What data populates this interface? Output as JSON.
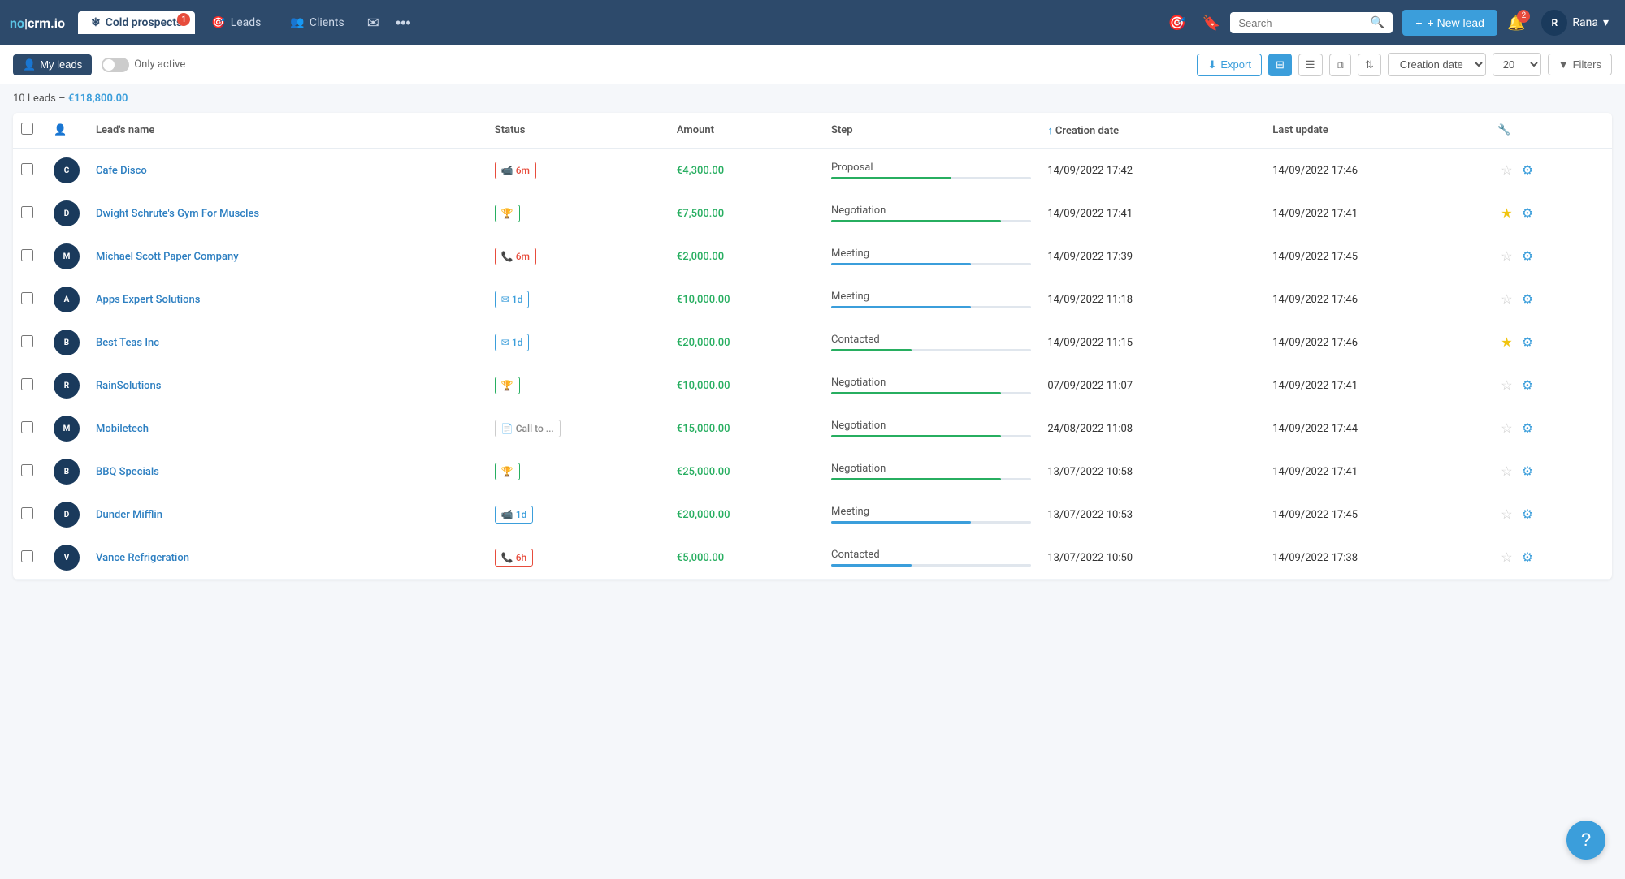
{
  "logo": "no|crm.io",
  "nav": {
    "tabs": [
      {
        "id": "cold-prospects",
        "label": "Cold prospects",
        "icon": "❄",
        "active": true,
        "badge": "1"
      },
      {
        "id": "leads",
        "label": "Leads",
        "icon": "🎯",
        "active": false
      },
      {
        "id": "clients",
        "label": "Clients",
        "icon": "👥",
        "active": false
      }
    ],
    "search_placeholder": "Search",
    "new_lead_label": "+ New lead",
    "notif_count": "2",
    "user_name": "Rana"
  },
  "subtoolbar": {
    "my_leads_label": "My leads",
    "only_active_label": "Only active",
    "export_label": "Export",
    "date_sort_label": "Creation date",
    "per_page": "20",
    "filters_label": "Filters"
  },
  "summary": {
    "count": "10 Leads",
    "amount": "€118,800.00"
  },
  "table": {
    "columns": [
      "Lead's name",
      "Status",
      "Amount",
      "Step",
      "Creation date",
      "Last update"
    ],
    "rows": [
      {
        "id": 1,
        "name": "Cafe Disco",
        "status_label": "6m",
        "status_type": "red",
        "status_icon": "📹",
        "amount": "€4,300.00",
        "step": "Proposal",
        "step_pct": 60,
        "step_color": "green",
        "created": "14/09/2022 17:42",
        "updated": "14/09/2022 17:46",
        "starred": false
      },
      {
        "id": 2,
        "name": "Dwight Schrute's Gym For Muscles",
        "status_label": "🏆",
        "status_type": "green",
        "status_icon": "",
        "amount": "€7,500.00",
        "step": "Negotiation",
        "step_pct": 85,
        "step_color": "green",
        "created": "14/09/2022 17:41",
        "updated": "14/09/2022 17:41",
        "starred": true
      },
      {
        "id": 3,
        "name": "Michael Scott Paper Company",
        "status_label": "6m",
        "status_type": "red",
        "status_icon": "📞",
        "amount": "€2,000.00",
        "step": "Meeting",
        "step_pct": 70,
        "step_color": "blue",
        "created": "14/09/2022 17:39",
        "updated": "14/09/2022 17:45",
        "starred": false
      },
      {
        "id": 4,
        "name": "Apps Expert Solutions",
        "status_label": "1d",
        "status_type": "blue",
        "status_icon": "✉",
        "amount": "€10,000.00",
        "step": "Meeting",
        "step_pct": 70,
        "step_color": "blue",
        "created": "14/09/2022 11:18",
        "updated": "14/09/2022 17:46",
        "starred": false
      },
      {
        "id": 5,
        "name": "Best Teas Inc",
        "status_label": "1d",
        "status_type": "blue",
        "status_icon": "✉",
        "amount": "€20,000.00",
        "step": "Contacted",
        "step_pct": 40,
        "step_color": "green",
        "created": "14/09/2022 11:15",
        "updated": "14/09/2022 17:46",
        "starred": true
      },
      {
        "id": 6,
        "name": "RainSolutions",
        "status_label": "🏆",
        "status_type": "green",
        "status_icon": "",
        "amount": "€10,000.00",
        "step": "Negotiation",
        "step_pct": 85,
        "step_color": "green",
        "created": "07/09/2022 11:07",
        "updated": "14/09/2022 17:41",
        "starred": false
      },
      {
        "id": 7,
        "name": "Mobiletech",
        "status_label": "Call to ...",
        "status_type": "gray",
        "status_icon": "📄",
        "amount": "€15,000.00",
        "step": "Negotiation",
        "step_pct": 85,
        "step_color": "green",
        "created": "24/08/2022 11:08",
        "updated": "14/09/2022 17:44",
        "starred": false
      },
      {
        "id": 8,
        "name": "BBQ Specials",
        "status_label": "🏆",
        "status_type": "green",
        "status_icon": "",
        "amount": "€25,000.00",
        "step": "Negotiation",
        "step_pct": 85,
        "step_color": "green",
        "created": "13/07/2022 10:58",
        "updated": "14/09/2022 17:41",
        "starred": false
      },
      {
        "id": 9,
        "name": "Dunder Mifflin",
        "status_label": "1d",
        "status_type": "blue",
        "status_icon": "📹",
        "amount": "€20,000.00",
        "step": "Meeting",
        "step_pct": 70,
        "step_color": "blue",
        "created": "13/07/2022 10:53",
        "updated": "14/09/2022 17:45",
        "starred": false
      },
      {
        "id": 10,
        "name": "Vance Refrigeration",
        "status_label": "6h",
        "status_type": "red",
        "status_icon": "📞",
        "amount": "€5,000.00",
        "step": "Contacted",
        "step_pct": 40,
        "step_color": "blue",
        "created": "13/07/2022 10:50",
        "updated": "14/09/2022 17:38",
        "starred": false
      }
    ]
  },
  "help_label": "?"
}
